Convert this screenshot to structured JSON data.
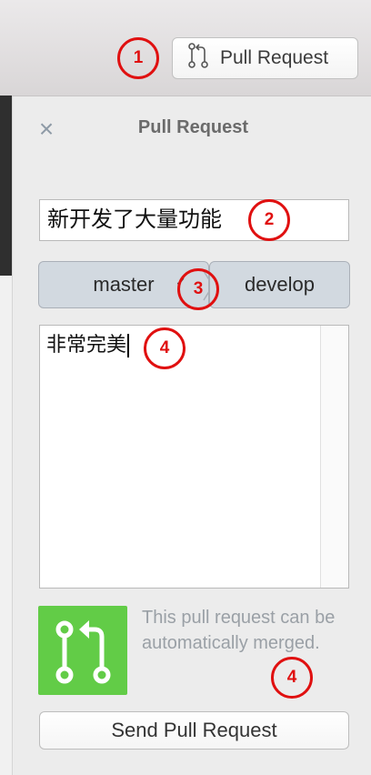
{
  "toolbar": {
    "pull_request_button_label": "Pull Request"
  },
  "panel": {
    "title": "Pull Request",
    "close_glyph": "×",
    "pr_title_value": "新开发了大量功能",
    "source_branch": "master",
    "source_branch_chevron": "✓",
    "target_branch": "develop",
    "description_value": "非常完美",
    "merge_status": "This pull request can be automatically merged.",
    "send_button_label": "Send Pull Request"
  },
  "annotations": {
    "m1": "1",
    "m2": "2",
    "m3": "3",
    "m4a": "4",
    "m4b": "4"
  },
  "colors": {
    "annotation_red": "#e01010",
    "merge_green": "#62cc47",
    "branch_bg": "#d2d9e0"
  },
  "icons": {
    "toolbar_icon": "pull-request-icon",
    "close_icon": "close-icon",
    "merge_icon": "pull-request-merge-icon"
  }
}
